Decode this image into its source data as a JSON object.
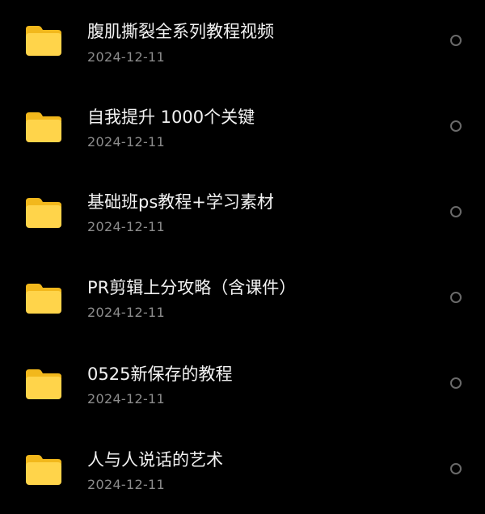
{
  "files": [
    {
      "name": "腹肌撕裂全系列教程视频",
      "date": "2024-12-11"
    },
    {
      "name": "自我提升 1000个关键",
      "date": "2024-12-11"
    },
    {
      "name": "基础班ps教程+学习素材",
      "date": "2024-12-11"
    },
    {
      "name": "PR剪辑上分攻略（含课件）",
      "date": "2024-12-11"
    },
    {
      "name": "0525新保存的教程",
      "date": "2024-12-11"
    },
    {
      "name": "人与人说话的艺术",
      "date": "2024-12-11"
    }
  ],
  "icons": {
    "folder": "folder-icon",
    "select": "radio-unselected-icon"
  },
  "colors": {
    "background": "#000000",
    "folder_body": "#FFD44A",
    "folder_tab": "#F2B81C",
    "title_text": "#F2F2F2",
    "date_text": "#8C8C8C"
  }
}
